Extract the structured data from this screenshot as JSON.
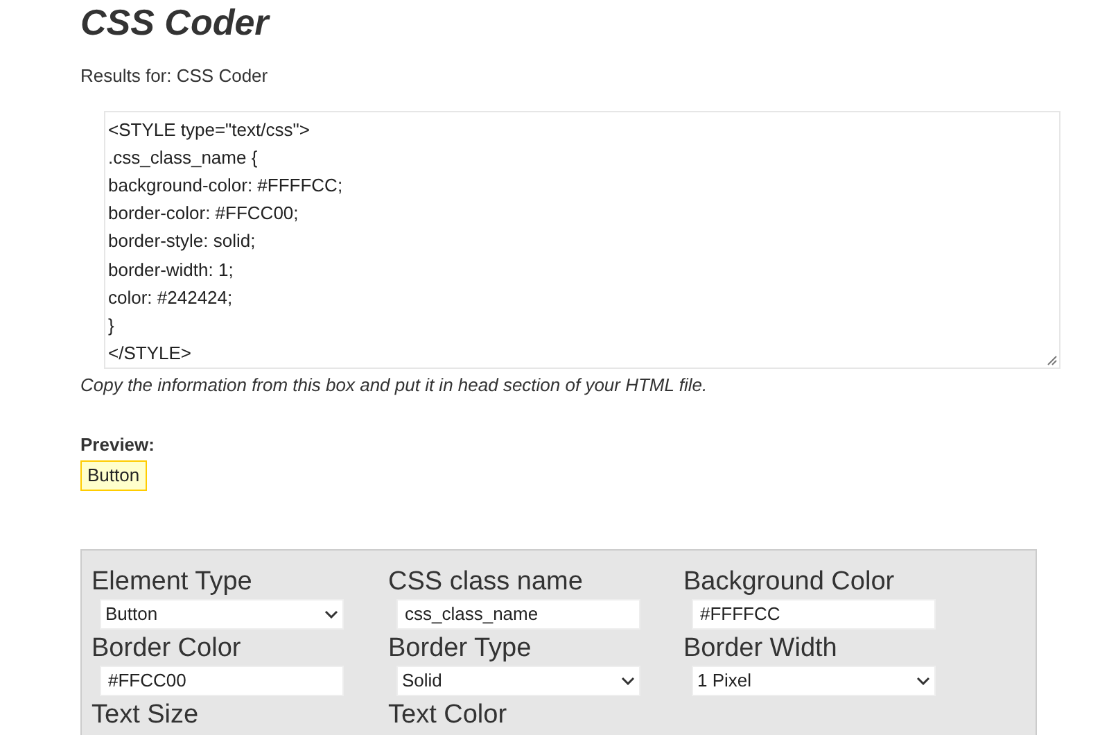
{
  "title": "CSS Coder",
  "results_text": "Results for: CSS Coder",
  "code_box": {
    "lines": [
      "<STYLE type=\"text/css\">",
      ".css_class_name {",
      "background-color: #FFFFCC;",
      "border-color: #FFCC00;",
      "border-style: solid;",
      "border-width: 1;",
      "color: #242424;",
      "}",
      "</STYLE>"
    ]
  },
  "instructions": "Copy the information from this box and put it in head section of your HTML file.",
  "preview": {
    "label": "Preview:",
    "button_label": "Button"
  },
  "settings": [
    {
      "label": "Element Type",
      "kind": "select",
      "value": "Button"
    },
    {
      "label": "CSS class name",
      "kind": "text",
      "value": "css_class_name"
    },
    {
      "label": "Background Color",
      "kind": "text",
      "value": "#FFFFCC"
    },
    {
      "label": "Border Color",
      "kind": "text",
      "value": "#FFCC00"
    },
    {
      "label": "Border Type",
      "kind": "select",
      "value": "Solid"
    },
    {
      "label": "Border Width",
      "kind": "select",
      "value": "1 Pixel"
    },
    {
      "label": "Text Size",
      "kind": "none"
    },
    {
      "label": "Text Color",
      "kind": "none"
    }
  ]
}
